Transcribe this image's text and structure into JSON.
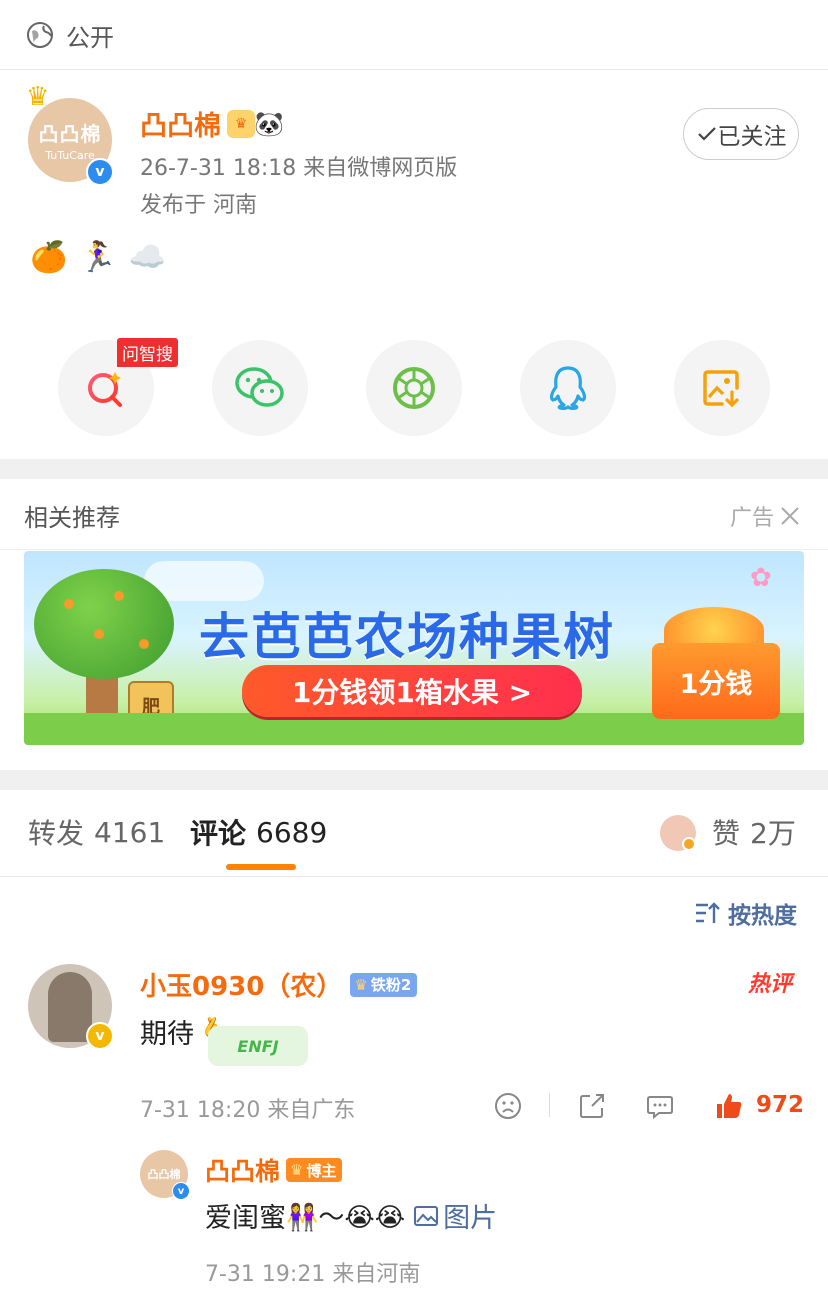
{
  "post": {
    "visibility": "公开",
    "author": {
      "name": "凸凸棉",
      "avatar_text_top": "凸凸棉",
      "avatar_text_bottom": "TuTuCare",
      "emoji_badges": [
        "🐼"
      ],
      "time_and_source": "26-7-31 18:18  来自微博网页版",
      "location": "发布于 河南"
    },
    "follow_button": "已关注",
    "content_emojis": [
      "🍊",
      "🏃‍♀️",
      "☁️"
    ]
  },
  "share": {
    "ai_search_tag": "问智搜",
    "buttons": [
      {
        "icon": "ai-search-icon"
      },
      {
        "icon": "wechat-icon"
      },
      {
        "icon": "moments-icon"
      },
      {
        "icon": "qq-icon"
      },
      {
        "icon": "save-image-icon"
      }
    ]
  },
  "recommend": {
    "title": "相关推荐",
    "ad_label": "广告",
    "banner": {
      "headline": "去芭芭农场种果树",
      "cta": "1分钱领1箱水果 >",
      "box_label": "1分钱",
      "fertilizer_label": "肥"
    }
  },
  "tabs": {
    "repost_label": "转发",
    "repost_count": "4161",
    "comment_label": "评论",
    "comment_count": "6689",
    "like_label": "赞",
    "like_count": "2万"
  },
  "sort_label": "按热度",
  "comments": [
    {
      "user": "小玉0930（农）",
      "fan_badge": "铁粉2",
      "hot_tag": "热评",
      "text": "期待",
      "emoji": "🫰",
      "sticker": "ENFJ",
      "time_location": "7-31 18:20  来自广东",
      "likes": "972",
      "reply": {
        "user": "凸凸棉",
        "badge": "博主",
        "avatar_text": "凸凸棉",
        "text": "爱闺蜜",
        "emojis": "👭～😭😭",
        "image_link": "图片",
        "time_location": "7-31 19:21  来自河南"
      }
    }
  ],
  "colors": {
    "accent_orange": "#f46b0e",
    "tab_indicator": "#ff8200",
    "link_blue": "#4f6ea0",
    "hot_red": "#ff3b30",
    "verified_blue": "#2c8cf0"
  }
}
